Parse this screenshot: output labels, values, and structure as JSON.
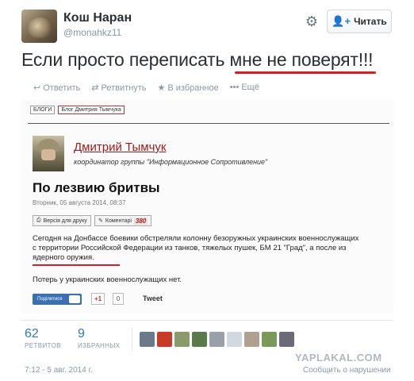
{
  "author": {
    "name": "Кош Наран",
    "handle": "@monahkz11",
    "avatar_icon": "avatar-photo"
  },
  "header": {
    "settings_icon": "gear-icon",
    "follow_label": "Читать",
    "follow_icon": "add-user-icon"
  },
  "tweet": {
    "text_before": "Если просто переписать ",
    "text_highlight": "мне не поверят!!!",
    "highlight_color": "#d42020"
  },
  "actions": {
    "reply": "Ответить",
    "retweet": "Ретвитнуть",
    "favorite": "В избранное",
    "more": "Ещё"
  },
  "embed": {
    "crumbs": [
      "БЛОГИ",
      "Блог Дмитрия Тымчука"
    ],
    "blog_author": "Дмитрий Тымчук",
    "blog_role": "координатор группы \"Информационное Сопротивление\"",
    "post_title": "По лезвию бритвы",
    "post_date": "Вторник, 05 августа 2014, 08:37",
    "print_label": "Версія для друку",
    "comments_label": "Коментарі",
    "comments_count": "380",
    "body_line1": "Сегодня на Донбассе боевики обстреляли колонну безоружных украинских военнослужащих",
    "body_line2": "с территории Российской Федерации из танков, тяжелых пушек, БМ 21 \"Град\", а после из",
    "body_line3": "ядерного оружия.",
    "body_line4": "Потерь у украинских военнослужащих нет.",
    "share_label": "Поділитися",
    "gplus_label": "+1",
    "gplus_count": "0",
    "tweet_label": "Tweet"
  },
  "stats": {
    "retweets_count": "62",
    "retweets_label": "РЕТВИТОВ",
    "favorites_count": "9",
    "favorites_label": "ИЗБРАННЫХ"
  },
  "favoriters": [
    "#6a7a8a",
    "#c83a2a",
    "#8a9a6a",
    "#5a7a4a",
    "#9aa0a8",
    "#d0d8e0",
    "#b0a090",
    "#7a9a5a",
    "#6a6a7a"
  ],
  "footer": {
    "timestamp": "7:12 - 5 авг. 2014 г.",
    "report": "Сообщить о нарушении",
    "watermark": "YAPLAKAL.COM"
  }
}
